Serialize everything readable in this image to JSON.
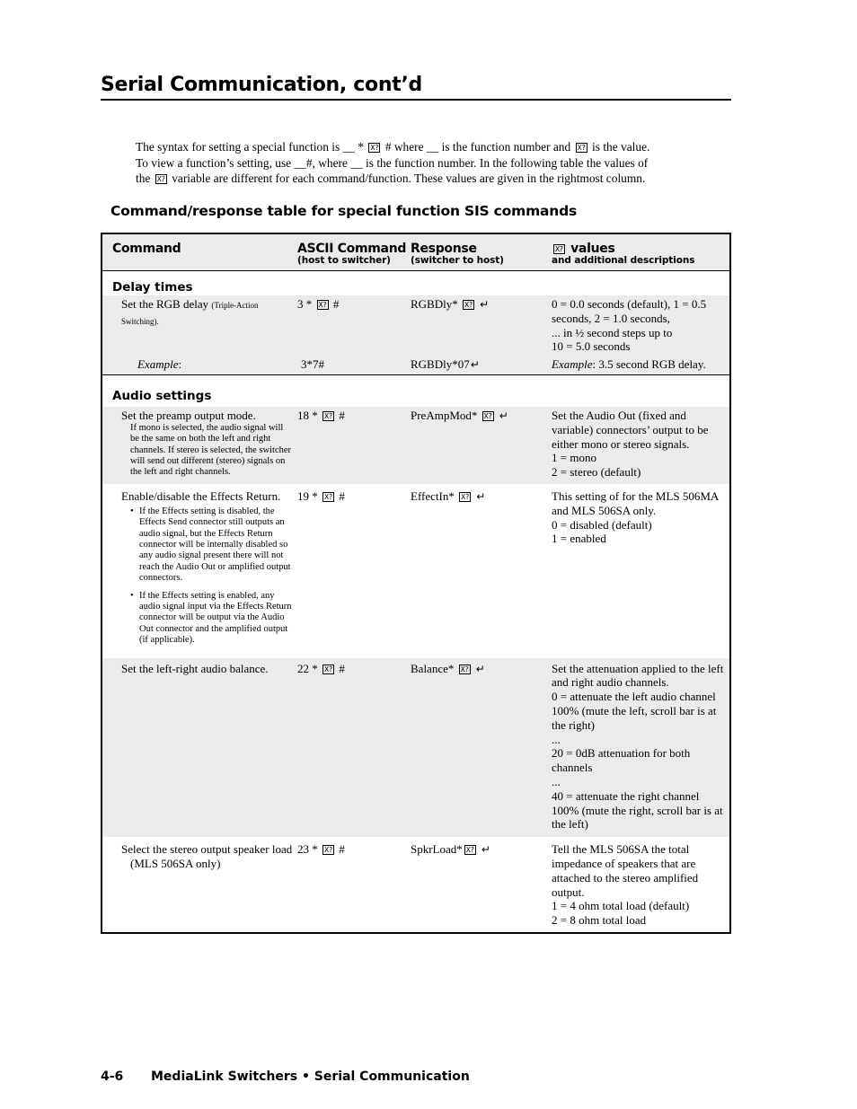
{
  "page": {
    "title": "Serial Communication, cont’d",
    "intro": {
      "line1_a": "The syntax for setting a special function is __ * ",
      "line1_b": " # where __ is the function number and ",
      "line1_c": " is the value.",
      "line2": "To view a function’s setting, use __#, where __ is the function number.  In the following table the values of",
      "line3_a": "the ",
      "line3_b": " variable are different for each command/function.  These values are given in the rightmost column."
    },
    "section_title": "Command/response table for special function SIS commands",
    "icons": {
      "variable": "X?",
      "return": "↵"
    }
  },
  "table": {
    "headers": {
      "command": "Command",
      "ascii": "ASCII Command",
      "ascii_sub": "(host to switcher)",
      "response": "Response",
      "response_sub": "(switcher to host)",
      "values": "values",
      "values_sub": "and additional descriptions"
    },
    "groups": {
      "delay": "Delay times",
      "audio": "Audio settings"
    },
    "rows": {
      "rgb": {
        "command": "Set the RGB delay",
        "command_note": "(Triple-Action Switching).",
        "ascii_prefix": "3 * ",
        "ascii_suffix": " #",
        "response_prefix": "RGBDly* ",
        "values": [
          "0 = 0.0 seconds (default), 1 = 0.5 seconds, 2 = 1.0 seconds,",
          "... in ½ second steps up to",
          "10 = 5.0 seconds"
        ],
        "example_label": "Example",
        "example_ascii": "3*7#",
        "example_response": "RGBDly*07",
        "example_value": ": 3.5 second RGB delay."
      },
      "preamp": {
        "command": "Set the preamp output mode.",
        "note": "If mono is selected, the audio signal will be the same on both the left and right channels.  If stereo is selected, the switcher will send out different (stereo) signals on the left and right channels.",
        "ascii_prefix": "18 * ",
        "ascii_suffix": " #",
        "response_prefix": "PreAmpMod* ",
        "values": [
          "Set the Audio Out (fixed and variable) connectors’ output to be either mono or stereo signals.",
          "1 = mono",
          "2 = stereo (default)"
        ]
      },
      "effects": {
        "command": "Enable/disable the Effects Return.",
        "bullets": [
          "If the Effects setting is disabled, the Effects Send connector still outputs an audio signal, but the Effects Return connector will be internally disabled so any audio signal present there will not reach the Audio Out or amplified output connectors.",
          "If the Effects setting is enabled, any audio signal input via the Effects Return connector will be output via the Audio Out connector and the amplified output (if applicable)."
        ],
        "ascii_prefix": "19 * ",
        "ascii_suffix": " #",
        "response_prefix": "EffectIn* ",
        "values": [
          "This setting of for the MLS 506MA and MLS 506SA only.",
          "0 = disabled (default)",
          "1 = enabled"
        ]
      },
      "balance": {
        "command": "Set the left-right audio balance.",
        "ascii_prefix": "22 * ",
        "ascii_suffix": " #",
        "response_prefix": "Balance* ",
        "values": [
          "Set the attenuation applied to the left and right audio channels.",
          "0 = attenuate the left audio channel 100% (mute the left, scroll bar is at the right)",
          "...",
          "20 = 0dB attenuation for both channels",
          "...",
          "40 = attenuate the right channel 100% (mute the right, scroll bar is at the left)"
        ]
      },
      "speaker": {
        "command": "Select the stereo output speaker load",
        "command_note": "(MLS 506SA only)",
        "ascii_prefix": "23 * ",
        "ascii_suffix": " #",
        "response_prefix": "SpkrLoad*",
        "values": [
          "Tell the MLS 506SA the total impedance of speakers that are attached to the stereo amplified output.",
          "1 = 4 ohm total load (default)",
          "2 = 8 ohm total load"
        ]
      }
    }
  },
  "footer": {
    "page_number": "4-6",
    "text": "MediaLink Switchers • Serial Communication"
  }
}
